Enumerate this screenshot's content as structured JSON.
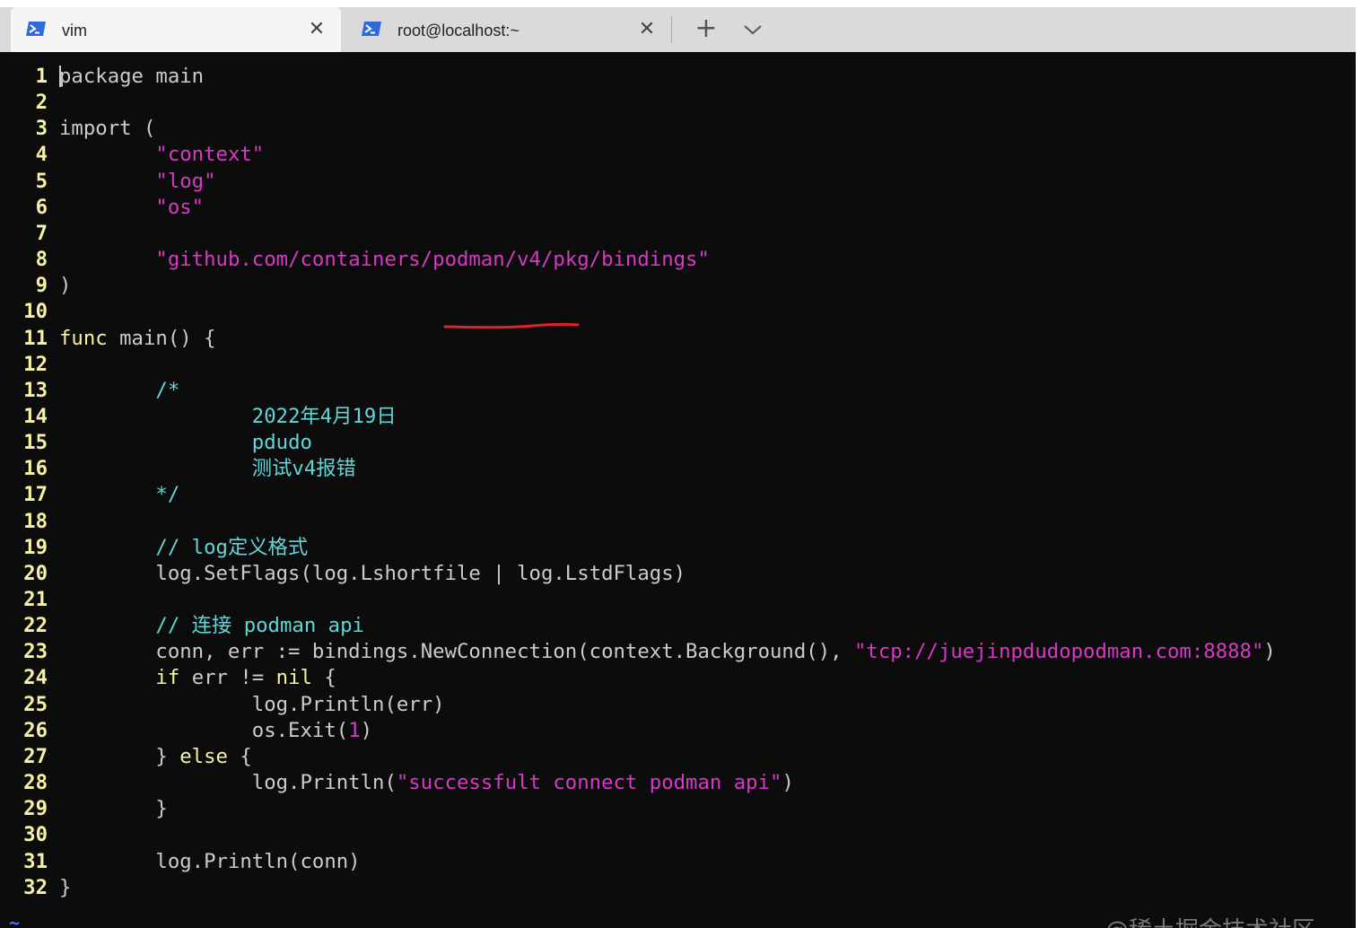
{
  "tabs": [
    {
      "title": "vim",
      "close": "✕",
      "active": true,
      "icon": "powershell-icon"
    },
    {
      "title": "root@localhost:~",
      "close": "✕",
      "active": false,
      "icon": "powershell-icon"
    }
  ],
  "tabbar": {
    "new_tab": "+",
    "dropdown_icon": "chevron-down-icon"
  },
  "editor": {
    "lines": [
      {
        "num": "1",
        "parts": [
          [
            "cursor",
            ""
          ],
          [
            "plain",
            "package main"
          ]
        ]
      },
      {
        "num": "2",
        "parts": []
      },
      {
        "num": "3",
        "parts": [
          [
            "plain",
            "import ("
          ]
        ]
      },
      {
        "num": "4",
        "parts": [
          [
            "plain",
            "        "
          ],
          [
            "str",
            "\"context\""
          ]
        ]
      },
      {
        "num": "5",
        "parts": [
          [
            "plain",
            "        "
          ],
          [
            "str",
            "\"log\""
          ]
        ]
      },
      {
        "num": "6",
        "parts": [
          [
            "plain",
            "        "
          ],
          [
            "str",
            "\"os\""
          ]
        ]
      },
      {
        "num": "7",
        "parts": []
      },
      {
        "num": "8",
        "parts": [
          [
            "plain",
            "        "
          ],
          [
            "str",
            "\"github.com/containers/podman/v4/pkg/bindings\""
          ]
        ]
      },
      {
        "num": "9",
        "parts": [
          [
            "plain",
            ")"
          ]
        ]
      },
      {
        "num": "10",
        "parts": []
      },
      {
        "num": "11",
        "parts": [
          [
            "kw",
            "func"
          ],
          [
            "plain",
            " main() {"
          ]
        ]
      },
      {
        "num": "12",
        "parts": []
      },
      {
        "num": "13",
        "parts": [
          [
            "plain",
            "        "
          ],
          [
            "cmt",
            "/*"
          ]
        ]
      },
      {
        "num": "14",
        "parts": [
          [
            "plain",
            "                "
          ],
          [
            "cmt",
            "2022年4月19日"
          ]
        ]
      },
      {
        "num": "15",
        "parts": [
          [
            "plain",
            "                "
          ],
          [
            "cmt",
            "pdudo"
          ]
        ]
      },
      {
        "num": "16",
        "parts": [
          [
            "plain",
            "                "
          ],
          [
            "cmt",
            "测试v4报错"
          ]
        ]
      },
      {
        "num": "17",
        "parts": [
          [
            "plain",
            "        "
          ],
          [
            "cmt",
            "*/"
          ]
        ]
      },
      {
        "num": "18",
        "parts": []
      },
      {
        "num": "19",
        "parts": [
          [
            "plain",
            "        "
          ],
          [
            "cmt",
            "// log定义格式"
          ]
        ]
      },
      {
        "num": "20",
        "parts": [
          [
            "plain",
            "        log.SetFlags(log.Lshortfile | log.LstdFlags)"
          ]
        ]
      },
      {
        "num": "21",
        "parts": []
      },
      {
        "num": "22",
        "parts": [
          [
            "plain",
            "        "
          ],
          [
            "cmt",
            "// 连接 podman api"
          ]
        ]
      },
      {
        "num": "23",
        "parts": [
          [
            "plain",
            "        conn, err := bindings.NewConnection(context.Background(), "
          ],
          [
            "str",
            "\"tcp://juejinpdudopodman.com:8888\""
          ],
          [
            "plain",
            ")"
          ]
        ]
      },
      {
        "num": "24",
        "parts": [
          [
            "plain",
            "        "
          ],
          [
            "kw",
            "if"
          ],
          [
            "plain",
            " err != "
          ],
          [
            "kw",
            "nil"
          ],
          [
            "plain",
            " {"
          ]
        ]
      },
      {
        "num": "25",
        "parts": [
          [
            "plain",
            "                log.Println(err)"
          ]
        ]
      },
      {
        "num": "26",
        "parts": [
          [
            "plain",
            "                os.Exit("
          ],
          [
            "str",
            "1"
          ],
          [
            "plain",
            ")"
          ]
        ]
      },
      {
        "num": "27",
        "parts": [
          [
            "plain",
            "        } "
          ],
          [
            "kw",
            "else"
          ],
          [
            "plain",
            " {"
          ]
        ]
      },
      {
        "num": "28",
        "parts": [
          [
            "plain",
            "                log.Println("
          ],
          [
            "str",
            "\"successfult connect podman api\""
          ],
          [
            "plain",
            ")"
          ]
        ]
      },
      {
        "num": "29",
        "parts": [
          [
            "plain",
            "        }"
          ]
        ]
      },
      {
        "num": "30",
        "parts": []
      },
      {
        "num": "31",
        "parts": [
          [
            "plain",
            "        log.Println(conn)"
          ]
        ]
      },
      {
        "num": "32",
        "parts": [
          [
            "plain",
            "}"
          ]
        ]
      }
    ],
    "empty_marker": "~"
  },
  "watermark": "@稀土掘金技术社区",
  "colors": {
    "background": "#0c0c0c",
    "line_number": "#f9f1a5",
    "keyword": "#f9f1a5",
    "string": "#d63ac5",
    "comment": "#61d6d6",
    "plain": "#cccccc",
    "annotation_underline": "#e0202a"
  }
}
